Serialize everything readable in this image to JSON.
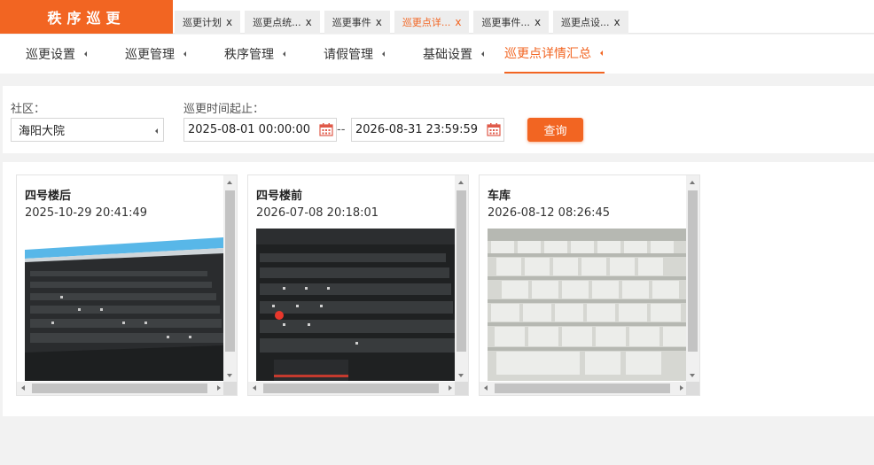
{
  "app": {
    "brand": "秩序巡更"
  },
  "doc_tabs": [
    {
      "label": "巡更计划",
      "close": "x",
      "active": false
    },
    {
      "label": "巡更点统...",
      "close": "x",
      "active": false
    },
    {
      "label": "巡更事件",
      "close": "x",
      "active": false
    },
    {
      "label": "巡更点详...",
      "close": "x",
      "active": true
    },
    {
      "label": "巡更事件...",
      "close": "x",
      "active": false
    },
    {
      "label": "巡更点设...",
      "close": "x",
      "active": false
    }
  ],
  "subnav": [
    {
      "label": "巡更设置",
      "active": false
    },
    {
      "label": "巡更管理",
      "active": false
    },
    {
      "label": "秩序管理",
      "active": false
    },
    {
      "label": "请假管理",
      "active": false
    },
    {
      "label": "基础设置",
      "active": false
    },
    {
      "label": "巡更点详情汇总",
      "active": true
    }
  ],
  "filter": {
    "community_label": "社区：",
    "community_value": "海阳大院",
    "time_label": "巡更时间起止：",
    "start_time": "2025-08-01 00:00:00",
    "range_separator": "--",
    "end_time": "2026-08-31 23:59:59",
    "query_label": "查询"
  },
  "records": [
    {
      "title": "四号楼后",
      "time": "2025-10-29 20:41:49",
      "photo": "keyboard-photo-dark-screen"
    },
    {
      "title": "四号楼前",
      "time": "2026-07-08 20:18:01",
      "photo": "keyboard-photo-dark-trackpoint"
    },
    {
      "title": "车库",
      "time": "2026-08-12 08:26:45",
      "photo": "keyboard-photo-white"
    }
  ],
  "colors": {
    "accent": "#f26522",
    "tab_bg": "#ededed",
    "page_bg": "#f2f2f2"
  }
}
